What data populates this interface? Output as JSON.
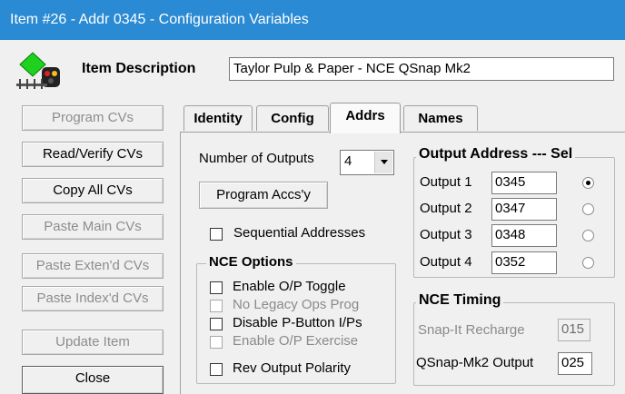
{
  "window": {
    "title": "Item #26 - Addr 0345 - Configuration Variables"
  },
  "header": {
    "description_label": "Item Description",
    "description_value": "Taylor Pulp & Paper - NCE QSnap Mk2",
    "icon": "signal-crossing-icon"
  },
  "left_buttons": [
    {
      "label": "Program CVs",
      "enabled": false
    },
    {
      "label": "Read/Verify CVs",
      "enabled": true
    },
    {
      "label": "Copy All CVs",
      "enabled": true
    },
    {
      "label": "Paste Main CVs",
      "enabled": false
    },
    {
      "label": "Paste Exten'd CVs",
      "enabled": false
    },
    {
      "label": "Paste Index'd CVs",
      "enabled": false
    },
    {
      "label": "Update Item",
      "enabled": false
    },
    {
      "label": "Close",
      "enabled": true
    }
  ],
  "tabs": [
    {
      "label": "Identity",
      "active": false
    },
    {
      "label": "Config",
      "active": false
    },
    {
      "label": "Addrs",
      "active": true
    },
    {
      "label": "Names",
      "active": false
    }
  ],
  "addrs": {
    "num_outputs_label": "Number of Outputs",
    "num_outputs_value": "4",
    "program_accsy_label": "Program Accs'y",
    "sequential_label": "Sequential Addresses",
    "sequential_checked": false,
    "nce_options": {
      "title": "NCE Options",
      "items": [
        {
          "label": "Enable O/P Toggle",
          "enabled": true,
          "checked": false
        },
        {
          "label": "No Legacy Ops Prog",
          "enabled": false,
          "checked": false
        },
        {
          "label": "Disable P-Button I/Ps",
          "enabled": true,
          "checked": false
        },
        {
          "label": "Enable O/P Exercise",
          "enabled": false,
          "checked": false
        },
        {
          "label": "Rev Output Polarity",
          "enabled": true,
          "checked": false
        }
      ]
    },
    "output_address": {
      "title": "Output Address --- Sel",
      "rows": [
        {
          "label": "Output 1",
          "value": "0345",
          "selected": true
        },
        {
          "label": "Output 2",
          "value": "0347",
          "selected": false
        },
        {
          "label": "Output 3",
          "value": "0348",
          "selected": false
        },
        {
          "label": "Output 4",
          "value": "0352",
          "selected": false
        }
      ]
    },
    "nce_timing": {
      "title": "NCE Timing",
      "snap_label": "Snap-It Recharge",
      "snap_value": "015",
      "qsnap_label": "QSnap-Mk2 Output",
      "qsnap_value": "025"
    }
  },
  "colors": {
    "titlebar": "#2a8ad3",
    "disabled_text": "#8d8d8d"
  }
}
